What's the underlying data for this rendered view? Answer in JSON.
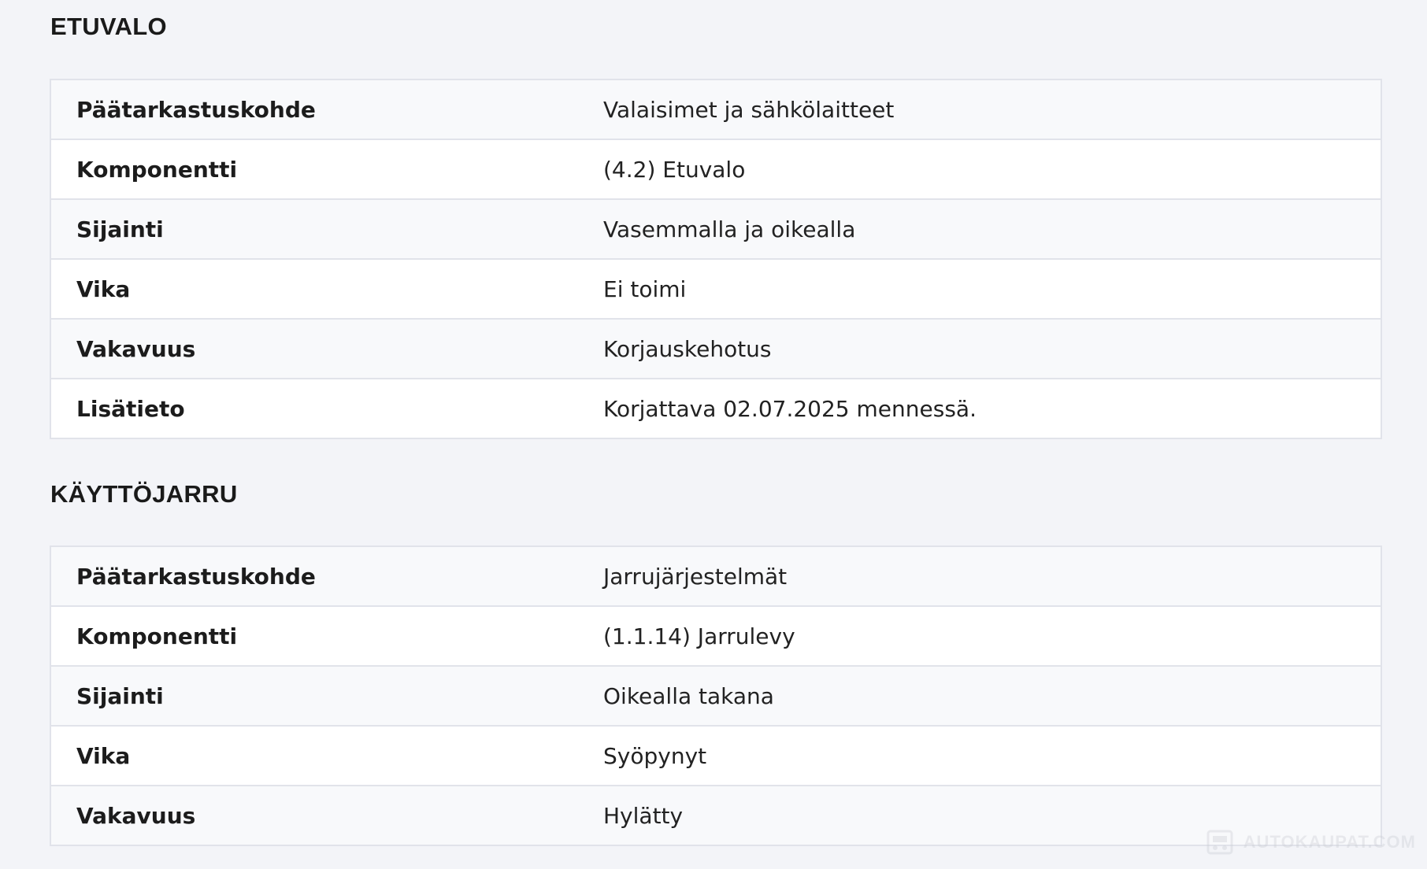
{
  "sections": [
    {
      "title": "ETUVALO",
      "rows": [
        {
          "key": "Päätarkastuskohde",
          "value": "Valaisimet ja sähkölaitteet"
        },
        {
          "key": "Komponentti",
          "value": "(4.2) Etuvalo"
        },
        {
          "key": "Sijainti",
          "value": "Vasemmalla ja oikealla"
        },
        {
          "key": "Vika",
          "value": "Ei toimi"
        },
        {
          "key": "Vakavuus",
          "value": "Korjauskehotus"
        },
        {
          "key": "Lisätieto",
          "value": "Korjattava 02.07.2025 mennessä."
        }
      ]
    },
    {
      "title": "KÄYTTÖJARRU",
      "rows": [
        {
          "key": "Päätarkastuskohde",
          "value": "Jarrujärjestelmät"
        },
        {
          "key": "Komponentti",
          "value": "(1.1.14) Jarrulevy"
        },
        {
          "key": "Sijainti",
          "value": "Oikealla takana"
        },
        {
          "key": "Vika",
          "value": "Syöpynyt"
        },
        {
          "key": "Vakavuus",
          "value": "Hylätty"
        }
      ]
    }
  ],
  "watermark": {
    "text": "AUTOKAUPAT.COM",
    "icon": "car-logo-icon"
  }
}
